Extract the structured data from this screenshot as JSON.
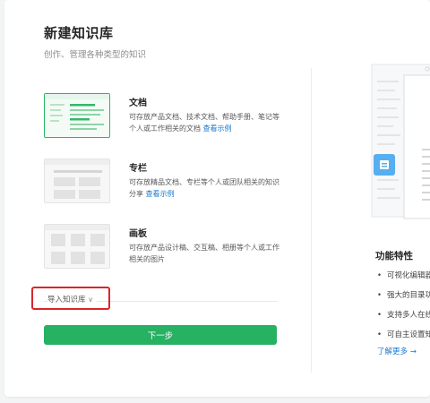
{
  "header": {
    "title": "新建知识库",
    "subtitle": "创作、管理各种类型的知识"
  },
  "options": [
    {
      "title": "文档",
      "desc": "可存放产品文档、技术文档、帮助手册、笔记等个人或工作相关的文档",
      "link": "查看示例",
      "selected": true
    },
    {
      "title": "专栏",
      "desc": "可存放精品文档、专栏等个人或团队相关的知识分享",
      "link": "查看示例",
      "selected": false
    },
    {
      "title": "画板",
      "desc": "可存放产品设计稿、交互稿、相册等个人或工作相关的图片",
      "link": "",
      "selected": false
    }
  ],
  "import": {
    "label": "导入知识库"
  },
  "next_button": {
    "label": "下一步"
  },
  "features": {
    "title": "功能特性",
    "items": [
      "可视化编辑器",
      "强大的目录功",
      "支持多人在线",
      "可自主设置知"
    ],
    "learn_more": "了解更多"
  },
  "colors": {
    "primary": "#27b163",
    "link": "#1677d2",
    "highlight": "#d9262c",
    "preview_badge": "#57aef0"
  }
}
